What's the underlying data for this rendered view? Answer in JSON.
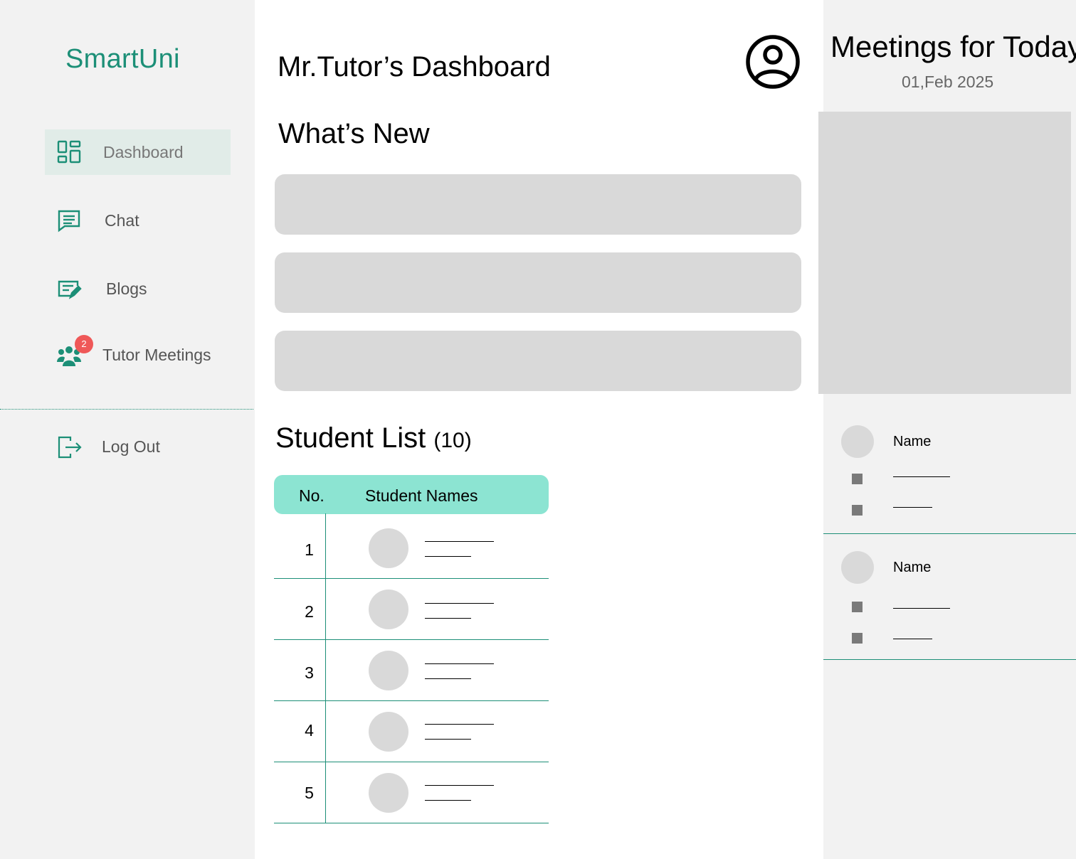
{
  "sidebar": {
    "brand": "SmartUni",
    "items": [
      {
        "label": "Dashboard",
        "icon": "dashboard-icon",
        "active": true
      },
      {
        "label": "Chat",
        "icon": "chat-icon"
      },
      {
        "label": "Blogs",
        "icon": "blog-edit-icon"
      },
      {
        "label": "Tutor Meetings",
        "icon": "group-icon",
        "badge": "2"
      }
    ],
    "logout": {
      "label": "Log Out",
      "icon": "logout-icon"
    }
  },
  "main": {
    "title": "Mr.Tutor’s Dashboard",
    "whats_new": "What’s New",
    "student_list": {
      "title": "Student List",
      "count": "(10)",
      "columns": [
        "No.",
        "Student Names"
      ],
      "rows": [
        "1",
        "2",
        "3",
        "4",
        "5"
      ]
    }
  },
  "meetings": {
    "title": "Meetings for Today",
    "date": "01,Feb 2025",
    "cards": [
      {
        "name": "Name"
      },
      {
        "name": "Name"
      }
    ]
  },
  "colors": {
    "accent": "#1c8f77",
    "table_header": "#8ce4d2",
    "badge": "#ef5858",
    "placeholder": "#d9d9d9",
    "panel_bg": "#f2f2f2"
  }
}
